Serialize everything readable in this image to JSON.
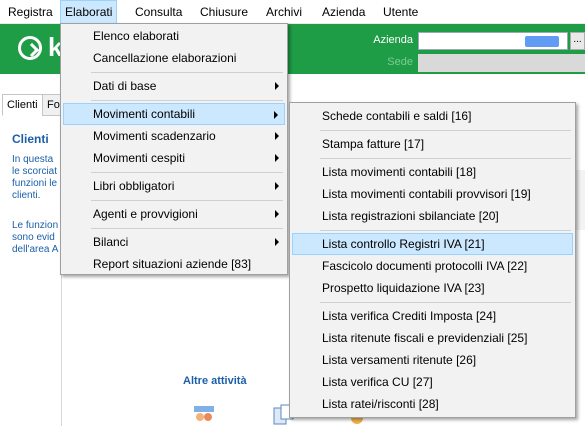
{
  "menubar": [
    "Registra",
    "Elaborati",
    "Consulta",
    "Chiusure",
    "Archivi",
    "Azienda",
    "Utente"
  ],
  "header": {
    "logo_text": "k",
    "azienda_label": "Azienda",
    "sede_label": "Sede",
    "browse_button": "..."
  },
  "tabs": [
    "Clienti",
    "Fo"
  ],
  "left_pane": {
    "title": "Clienti",
    "lines1": [
      "In questa",
      "le scorciat",
      "funzioni le",
      "clienti."
    ],
    "lines2": [
      "Le funzion",
      "sono evid",
      "dell'area A"
    ]
  },
  "main": {
    "altre_attivita": "Altre attività"
  },
  "elaborati_menu": {
    "items": [
      {
        "label": "Elenco elaborati",
        "submenu": false
      },
      {
        "label": "Cancellazione elaborazioni",
        "submenu": false
      },
      {
        "label": "Dati di base",
        "submenu": true
      },
      {
        "label": "Movimenti contabili",
        "submenu": true,
        "highlighted": true
      },
      {
        "label": "Movimenti scadenzario",
        "submenu": true
      },
      {
        "label": "Movimenti cespiti",
        "submenu": true
      },
      {
        "label": "Libri obbligatori",
        "submenu": true
      },
      {
        "label": "Agenti e provvigioni",
        "submenu": true
      },
      {
        "label": "Bilanci",
        "submenu": true
      },
      {
        "label": "Report situazioni aziende [83]",
        "submenu": false
      }
    ]
  },
  "movimenti_menu": {
    "items": [
      {
        "label": "Schede contabili e saldi [16]"
      },
      {
        "label": "Stampa fatture [17]"
      },
      {
        "label": "Lista movimenti contabili [18]"
      },
      {
        "label": "Lista movimenti contabili provvisori [19]"
      },
      {
        "label": "Lista registrazioni sbilanciate [20]"
      },
      {
        "label": "Lista controllo Registri IVA [21]",
        "highlighted": true
      },
      {
        "label": "Fascicolo documenti protocolli IVA [22]"
      },
      {
        "label": "Prospetto liquidazione IVA [23]"
      },
      {
        "label": "Lista verifica Crediti Imposta [24]"
      },
      {
        "label": "Lista ritenute fiscali e previdenziali [25]"
      },
      {
        "label": "Lista versamenti ritenute [26]"
      },
      {
        "label": "Lista verifica CU [27]"
      },
      {
        "label": "Lista ratei/risconti [28]"
      }
    ]
  },
  "colors": {
    "header_green": "#1e9c46",
    "highlight": "#cce8ff",
    "highlight_border": "#99d1ff",
    "link_blue": "#1b5fa8"
  }
}
